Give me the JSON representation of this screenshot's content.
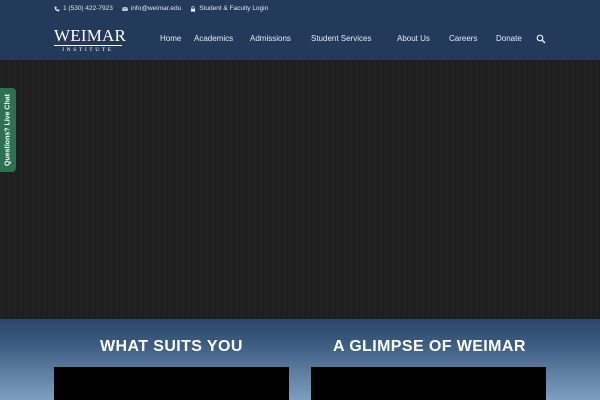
{
  "topbar": {
    "phone": "1 (530) 422-7923",
    "email": "info@weimar.edu",
    "login": "Student & Faculty Login"
  },
  "logo": {
    "name": "WEIMAR",
    "subtitle": "INSTITUTE"
  },
  "nav": {
    "items": [
      "Home",
      "Academics",
      "Admissions",
      "Student Services",
      "About Us",
      "Careers",
      "Donate"
    ]
  },
  "livechat": {
    "label": "Questions? Live Chat"
  },
  "sections": {
    "left_title": "WHAT SUITS YOU",
    "right_title": "A GLIMPSE OF WEIMAR"
  },
  "colors": {
    "header_bg": "#233a5a",
    "livechat_bg": "#2f6f52",
    "hero_bg": "#1f1f1f"
  },
  "icons": {
    "phone": "phone-icon",
    "email": "envelope-icon",
    "login": "lock-icon",
    "search": "search-icon"
  }
}
